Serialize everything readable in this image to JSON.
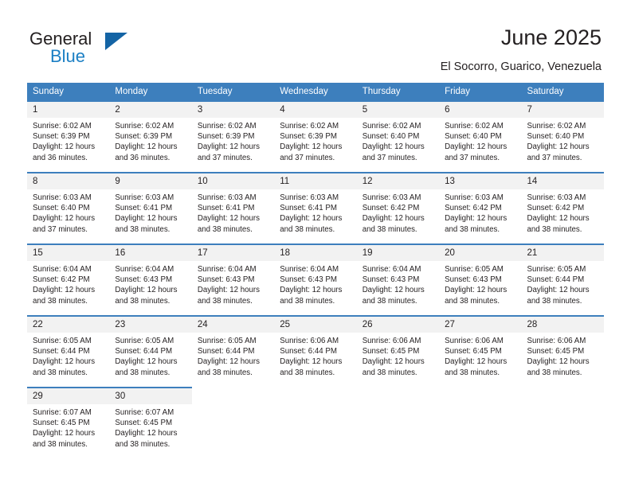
{
  "brand": {
    "name_part1": "General",
    "name_part2": "Blue",
    "triangle_color": "#1464a5",
    "blue_color": "#1b7fc4"
  },
  "header": {
    "title": "June 2025",
    "location": "El Socorro, Guarico, Venezuela",
    "accent_color": "#3d7fbd",
    "daynum_bg": "#f2f2f2"
  },
  "weekdays": [
    "Sunday",
    "Monday",
    "Tuesday",
    "Wednesday",
    "Thursday",
    "Friday",
    "Saturday"
  ],
  "weeks": [
    [
      {
        "day": "1",
        "sunrise": "Sunrise: 6:02 AM",
        "sunset": "Sunset: 6:39 PM",
        "daylight1": "Daylight: 12 hours",
        "daylight2": "and 36 minutes."
      },
      {
        "day": "2",
        "sunrise": "Sunrise: 6:02 AM",
        "sunset": "Sunset: 6:39 PM",
        "daylight1": "Daylight: 12 hours",
        "daylight2": "and 36 minutes."
      },
      {
        "day": "3",
        "sunrise": "Sunrise: 6:02 AM",
        "sunset": "Sunset: 6:39 PM",
        "daylight1": "Daylight: 12 hours",
        "daylight2": "and 37 minutes."
      },
      {
        "day": "4",
        "sunrise": "Sunrise: 6:02 AM",
        "sunset": "Sunset: 6:39 PM",
        "daylight1": "Daylight: 12 hours",
        "daylight2": "and 37 minutes."
      },
      {
        "day": "5",
        "sunrise": "Sunrise: 6:02 AM",
        "sunset": "Sunset: 6:40 PM",
        "daylight1": "Daylight: 12 hours",
        "daylight2": "and 37 minutes."
      },
      {
        "day": "6",
        "sunrise": "Sunrise: 6:02 AM",
        "sunset": "Sunset: 6:40 PM",
        "daylight1": "Daylight: 12 hours",
        "daylight2": "and 37 minutes."
      },
      {
        "day": "7",
        "sunrise": "Sunrise: 6:02 AM",
        "sunset": "Sunset: 6:40 PM",
        "daylight1": "Daylight: 12 hours",
        "daylight2": "and 37 minutes."
      }
    ],
    [
      {
        "day": "8",
        "sunrise": "Sunrise: 6:03 AM",
        "sunset": "Sunset: 6:40 PM",
        "daylight1": "Daylight: 12 hours",
        "daylight2": "and 37 minutes."
      },
      {
        "day": "9",
        "sunrise": "Sunrise: 6:03 AM",
        "sunset": "Sunset: 6:41 PM",
        "daylight1": "Daylight: 12 hours",
        "daylight2": "and 38 minutes."
      },
      {
        "day": "10",
        "sunrise": "Sunrise: 6:03 AM",
        "sunset": "Sunset: 6:41 PM",
        "daylight1": "Daylight: 12 hours",
        "daylight2": "and 38 minutes."
      },
      {
        "day": "11",
        "sunrise": "Sunrise: 6:03 AM",
        "sunset": "Sunset: 6:41 PM",
        "daylight1": "Daylight: 12 hours",
        "daylight2": "and 38 minutes."
      },
      {
        "day": "12",
        "sunrise": "Sunrise: 6:03 AM",
        "sunset": "Sunset: 6:42 PM",
        "daylight1": "Daylight: 12 hours",
        "daylight2": "and 38 minutes."
      },
      {
        "day": "13",
        "sunrise": "Sunrise: 6:03 AM",
        "sunset": "Sunset: 6:42 PM",
        "daylight1": "Daylight: 12 hours",
        "daylight2": "and 38 minutes."
      },
      {
        "day": "14",
        "sunrise": "Sunrise: 6:03 AM",
        "sunset": "Sunset: 6:42 PM",
        "daylight1": "Daylight: 12 hours",
        "daylight2": "and 38 minutes."
      }
    ],
    [
      {
        "day": "15",
        "sunrise": "Sunrise: 6:04 AM",
        "sunset": "Sunset: 6:42 PM",
        "daylight1": "Daylight: 12 hours",
        "daylight2": "and 38 minutes."
      },
      {
        "day": "16",
        "sunrise": "Sunrise: 6:04 AM",
        "sunset": "Sunset: 6:43 PM",
        "daylight1": "Daylight: 12 hours",
        "daylight2": "and 38 minutes."
      },
      {
        "day": "17",
        "sunrise": "Sunrise: 6:04 AM",
        "sunset": "Sunset: 6:43 PM",
        "daylight1": "Daylight: 12 hours",
        "daylight2": "and 38 minutes."
      },
      {
        "day": "18",
        "sunrise": "Sunrise: 6:04 AM",
        "sunset": "Sunset: 6:43 PM",
        "daylight1": "Daylight: 12 hours",
        "daylight2": "and 38 minutes."
      },
      {
        "day": "19",
        "sunrise": "Sunrise: 6:04 AM",
        "sunset": "Sunset: 6:43 PM",
        "daylight1": "Daylight: 12 hours",
        "daylight2": "and 38 minutes."
      },
      {
        "day": "20",
        "sunrise": "Sunrise: 6:05 AM",
        "sunset": "Sunset: 6:43 PM",
        "daylight1": "Daylight: 12 hours",
        "daylight2": "and 38 minutes."
      },
      {
        "day": "21",
        "sunrise": "Sunrise: 6:05 AM",
        "sunset": "Sunset: 6:44 PM",
        "daylight1": "Daylight: 12 hours",
        "daylight2": "and 38 minutes."
      }
    ],
    [
      {
        "day": "22",
        "sunrise": "Sunrise: 6:05 AM",
        "sunset": "Sunset: 6:44 PM",
        "daylight1": "Daylight: 12 hours",
        "daylight2": "and 38 minutes."
      },
      {
        "day": "23",
        "sunrise": "Sunrise: 6:05 AM",
        "sunset": "Sunset: 6:44 PM",
        "daylight1": "Daylight: 12 hours",
        "daylight2": "and 38 minutes."
      },
      {
        "day": "24",
        "sunrise": "Sunrise: 6:05 AM",
        "sunset": "Sunset: 6:44 PM",
        "daylight1": "Daylight: 12 hours",
        "daylight2": "and 38 minutes."
      },
      {
        "day": "25",
        "sunrise": "Sunrise: 6:06 AM",
        "sunset": "Sunset: 6:44 PM",
        "daylight1": "Daylight: 12 hours",
        "daylight2": "and 38 minutes."
      },
      {
        "day": "26",
        "sunrise": "Sunrise: 6:06 AM",
        "sunset": "Sunset: 6:45 PM",
        "daylight1": "Daylight: 12 hours",
        "daylight2": "and 38 minutes."
      },
      {
        "day": "27",
        "sunrise": "Sunrise: 6:06 AM",
        "sunset": "Sunset: 6:45 PM",
        "daylight1": "Daylight: 12 hours",
        "daylight2": "and 38 minutes."
      },
      {
        "day": "28",
        "sunrise": "Sunrise: 6:06 AM",
        "sunset": "Sunset: 6:45 PM",
        "daylight1": "Daylight: 12 hours",
        "daylight2": "and 38 minutes."
      }
    ],
    [
      {
        "day": "29",
        "sunrise": "Sunrise: 6:07 AM",
        "sunset": "Sunset: 6:45 PM",
        "daylight1": "Daylight: 12 hours",
        "daylight2": "and 38 minutes."
      },
      {
        "day": "30",
        "sunrise": "Sunrise: 6:07 AM",
        "sunset": "Sunset: 6:45 PM",
        "daylight1": "Daylight: 12 hours",
        "daylight2": "and 38 minutes."
      },
      {
        "day": "",
        "sunrise": "",
        "sunset": "",
        "daylight1": "",
        "daylight2": ""
      },
      {
        "day": "",
        "sunrise": "",
        "sunset": "",
        "daylight1": "",
        "daylight2": ""
      },
      {
        "day": "",
        "sunrise": "",
        "sunset": "",
        "daylight1": "",
        "daylight2": ""
      },
      {
        "day": "",
        "sunrise": "",
        "sunset": "",
        "daylight1": "",
        "daylight2": ""
      },
      {
        "day": "",
        "sunrise": "",
        "sunset": "",
        "daylight1": "",
        "daylight2": ""
      }
    ]
  ]
}
